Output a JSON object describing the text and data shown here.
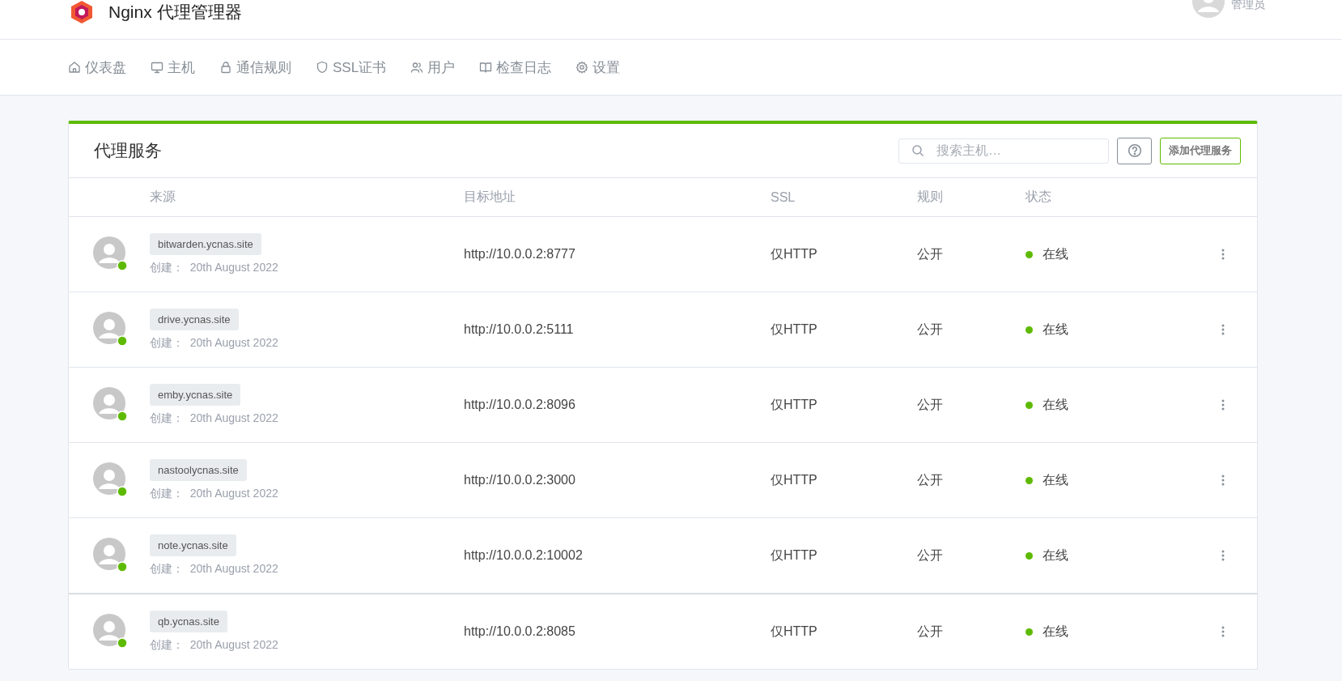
{
  "header": {
    "title": "Nginx 代理管理器",
    "user_role": "管理员"
  },
  "nav": [
    {
      "label": "仪表盘"
    },
    {
      "label": "主机"
    },
    {
      "label": "通信规则"
    },
    {
      "label": "SSL证书"
    },
    {
      "label": "用户"
    },
    {
      "label": "检查日志"
    },
    {
      "label": "设置"
    }
  ],
  "card": {
    "title": "代理服务",
    "search": {
      "placeholder": "搜索主机…"
    },
    "add_button": "添加代理服务"
  },
  "table": {
    "columns": [
      "来源",
      "目标地址",
      "SSL",
      "规则",
      "状态"
    ],
    "rows": [
      {
        "domain": "bitwarden.ycnas.site",
        "created": "创建：  20th August 2022",
        "target": "http://10.0.0.2:8777",
        "ssl": "仅HTTP",
        "rule": "公开",
        "status": "在线",
        "online": true
      },
      {
        "domain": "drive.ycnas.site",
        "created": "创建：  20th August 2022",
        "target": "http://10.0.0.2:5111",
        "ssl": "仅HTTP",
        "rule": "公开",
        "status": "在线",
        "online": true
      },
      {
        "domain": "emby.ycnas.site",
        "created": "创建：  20th August 2022",
        "target": "http://10.0.0.2:8096",
        "ssl": "仅HTTP",
        "rule": "公开",
        "status": "在线",
        "online": true
      },
      {
        "domain": "nastoolycnas.site",
        "created": "创建：  20th August 2022",
        "target": "http://10.0.0.2:3000",
        "ssl": "仅HTTP",
        "rule": "公开",
        "status": "在线",
        "online": true
      },
      {
        "domain": "note.ycnas.site",
        "created": "创建：  20th August 2022",
        "target": "http://10.0.0.2:10002",
        "ssl": "仅HTTP",
        "rule": "公开",
        "status": "在线",
        "online": true
      },
      {
        "domain": "qb.ycnas.site",
        "created": "创建：  20th August 2022",
        "target": "http://10.0.0.2:8085",
        "ssl": "仅HTTP",
        "rule": "公开",
        "status": "在线",
        "online": true
      }
    ]
  }
}
